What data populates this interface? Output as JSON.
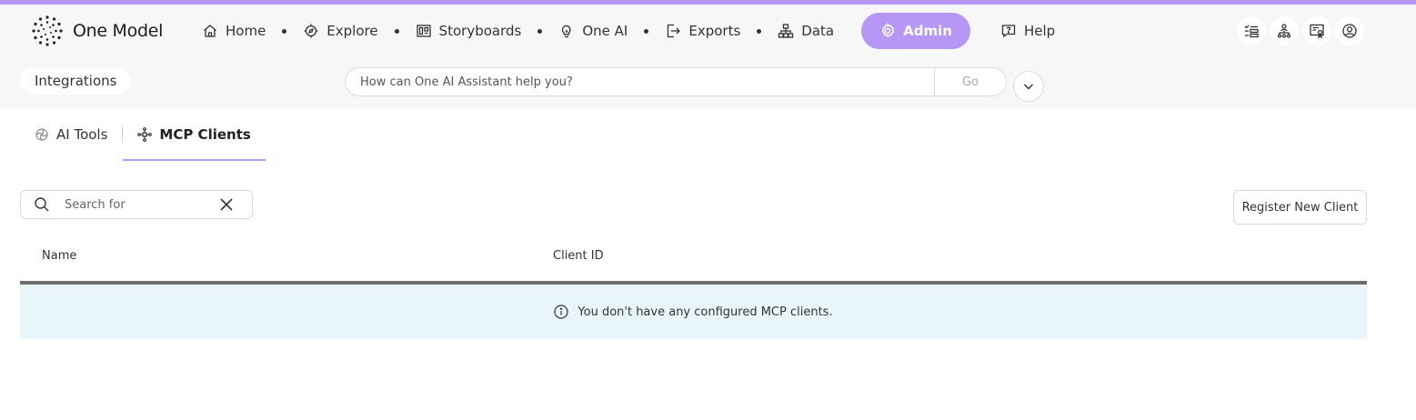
{
  "brand": {
    "name": "One Model",
    "accent_color": "#b697f5"
  },
  "nav": {
    "items": [
      {
        "label": "Home",
        "icon": "home-icon"
      },
      {
        "label": "Explore",
        "icon": "compass-icon"
      },
      {
        "label": "Storyboards",
        "icon": "storyboard-icon"
      },
      {
        "label": "One AI",
        "icon": "lightbulb-icon"
      },
      {
        "label": "Exports",
        "icon": "export-icon"
      },
      {
        "label": "Data",
        "icon": "hierarchy-icon"
      }
    ],
    "admin_label": "Admin",
    "help_label": "Help"
  },
  "header_actions": [
    "tasks-icon",
    "org-chart-icon",
    "certificate-icon",
    "user-profile-icon"
  ],
  "page": {
    "title": "Integrations"
  },
  "assistant": {
    "placeholder": "How can One AI Assistant help you?",
    "go_label": "Go"
  },
  "tabs": [
    {
      "label": "AI Tools",
      "active": false
    },
    {
      "label": "MCP Clients",
      "active": true
    }
  ],
  "search": {
    "placeholder": "Search for"
  },
  "register_label": "Register New Client",
  "table": {
    "columns": [
      "Name",
      "Client ID"
    ],
    "empty_message": "You don't have any configured MCP clients."
  }
}
